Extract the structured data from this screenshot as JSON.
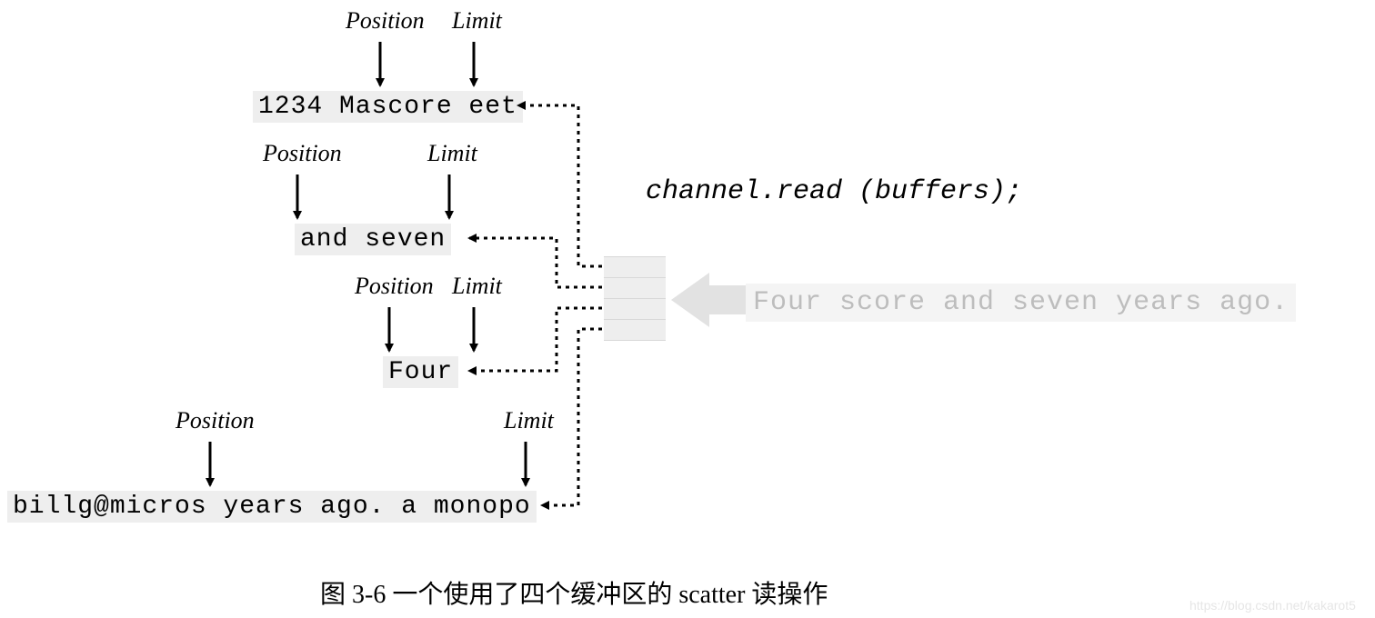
{
  "labels": {
    "position": "Position",
    "limit": "Limit"
  },
  "buffers": {
    "b1": "1234 Mascore eet",
    "b2": "and seven",
    "b3": "Four",
    "b4": "billg@micros years ago. a monopo"
  },
  "code": "channel.read (buffers);",
  "input_stream": "Four score and seven years ago.",
  "caption": "图 3-6 一个使用了四个缓冲区的 scatter 读操作",
  "watermark": "https://blog.csdn.net/kakarot5"
}
